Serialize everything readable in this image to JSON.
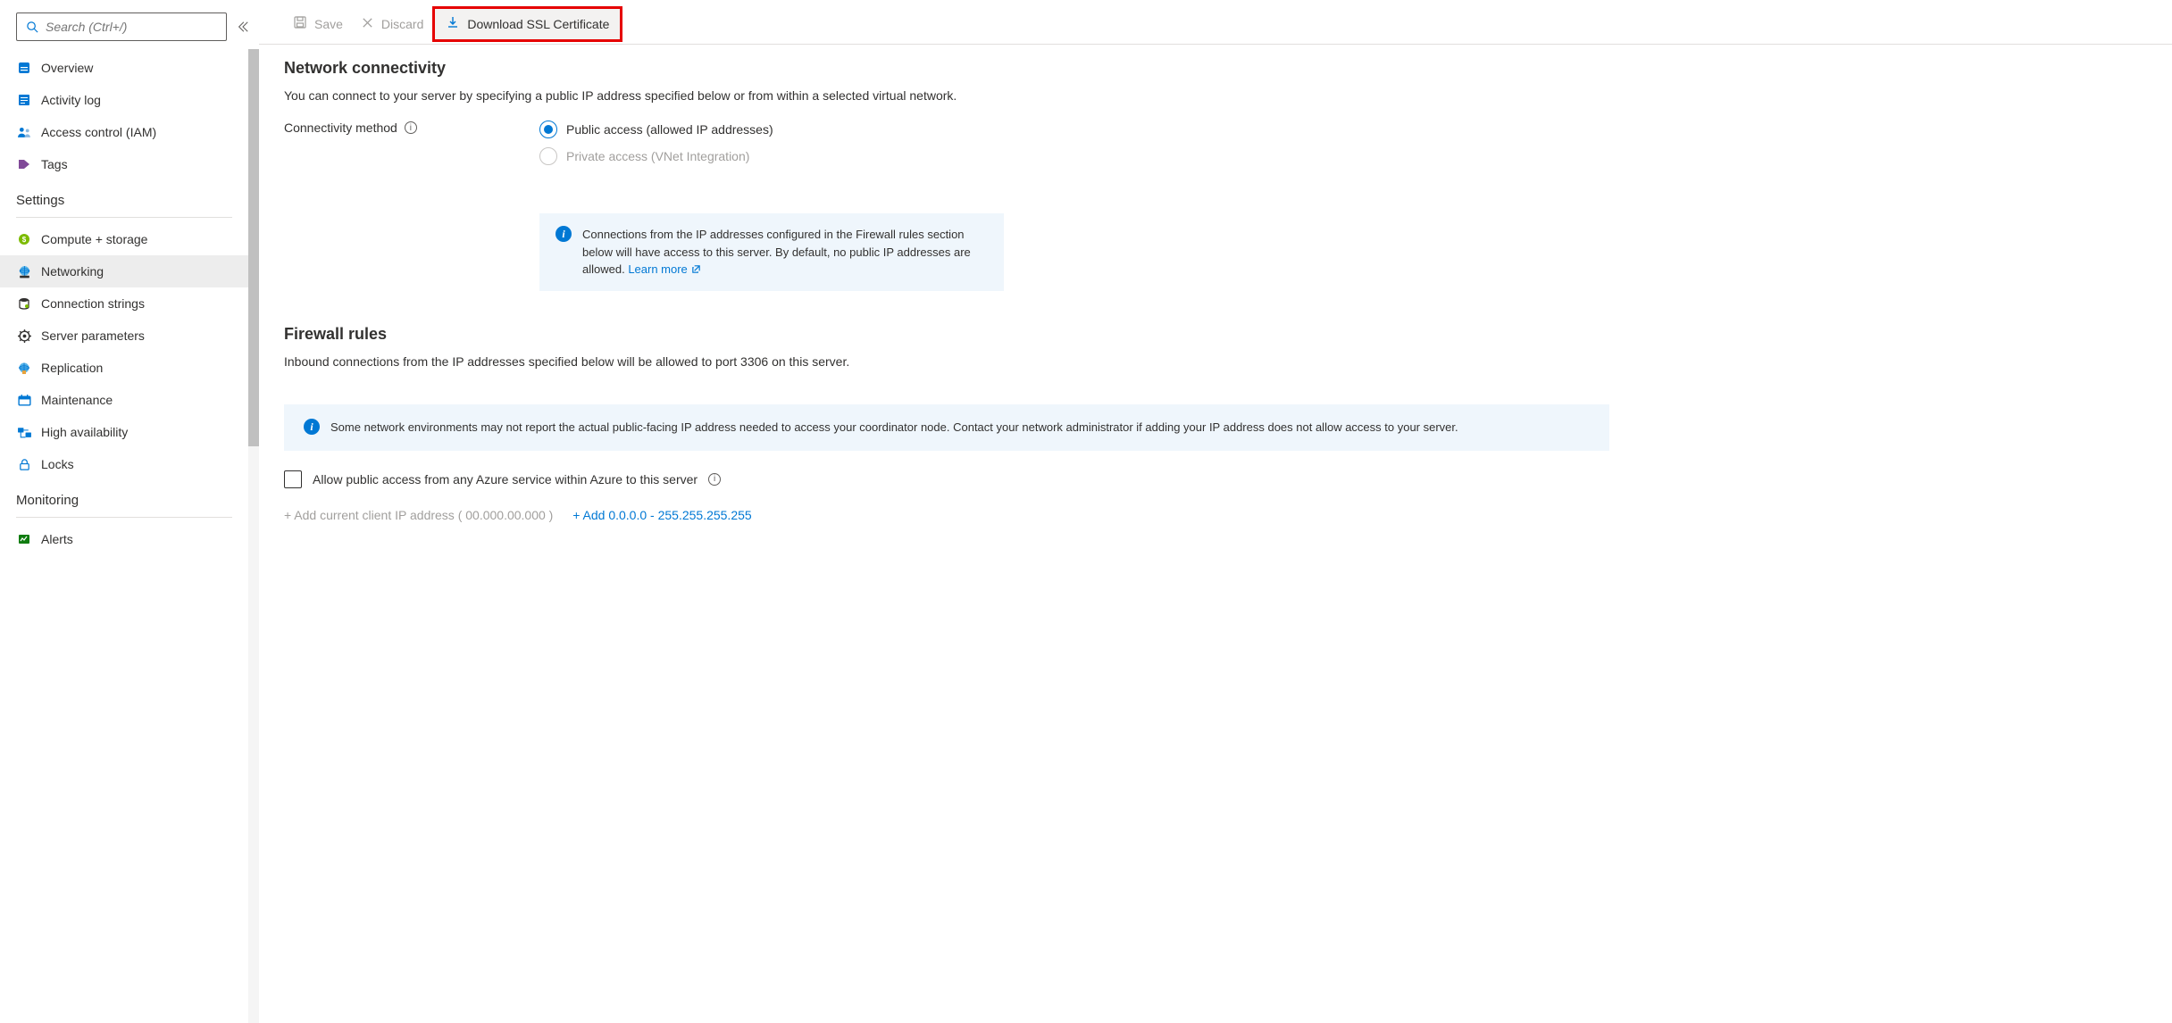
{
  "sidebar": {
    "search_placeholder": "Search (Ctrl+/)",
    "nav_primary": [
      {
        "label": "Overview"
      },
      {
        "label": "Activity log"
      },
      {
        "label": "Access control (IAM)"
      },
      {
        "label": "Tags"
      }
    ],
    "heading_settings": "Settings",
    "nav_settings": [
      {
        "label": "Compute + storage"
      },
      {
        "label": "Networking",
        "active": true
      },
      {
        "label": "Connection strings"
      },
      {
        "label": "Server parameters"
      },
      {
        "label": "Replication"
      },
      {
        "label": "Maintenance"
      },
      {
        "label": "High availability"
      },
      {
        "label": "Locks"
      }
    ],
    "heading_monitoring": "Monitoring",
    "nav_monitoring": [
      {
        "label": "Alerts"
      }
    ]
  },
  "toolbar": {
    "save": "Save",
    "discard": "Discard",
    "download": "Download SSL Certificate"
  },
  "connectivity": {
    "title": "Network connectivity",
    "desc": "You can connect to your server by specifying a public IP address specified below or from within a selected virtual network.",
    "method_label": "Connectivity method",
    "option_public": "Public access (allowed IP addresses)",
    "option_private": "Private access (VNet Integration)",
    "info_text": "Connections from the IP addresses configured in the Firewall rules section below will have access to this server. By default, no public IP addresses are allowed. ",
    "info_link": "Learn more"
  },
  "firewall": {
    "title": "Firewall rules",
    "desc": "Inbound connections from the IP addresses specified below will be allowed to port 3306 on this server.",
    "banner": "Some network environments may not report the actual public-facing IP address needed to access your coordinator node. Contact your network administrator if adding your IP address does not allow access to your server.",
    "allow_azure": "Allow public access from any Azure service within Azure to this server",
    "add_client_prefix": "+ Add current client IP address ( ",
    "add_client_ip": "00.000.00.000",
    "add_client_suffix": " )",
    "add_range": "+ Add 0.0.0.0 - 255.255.255.255"
  }
}
